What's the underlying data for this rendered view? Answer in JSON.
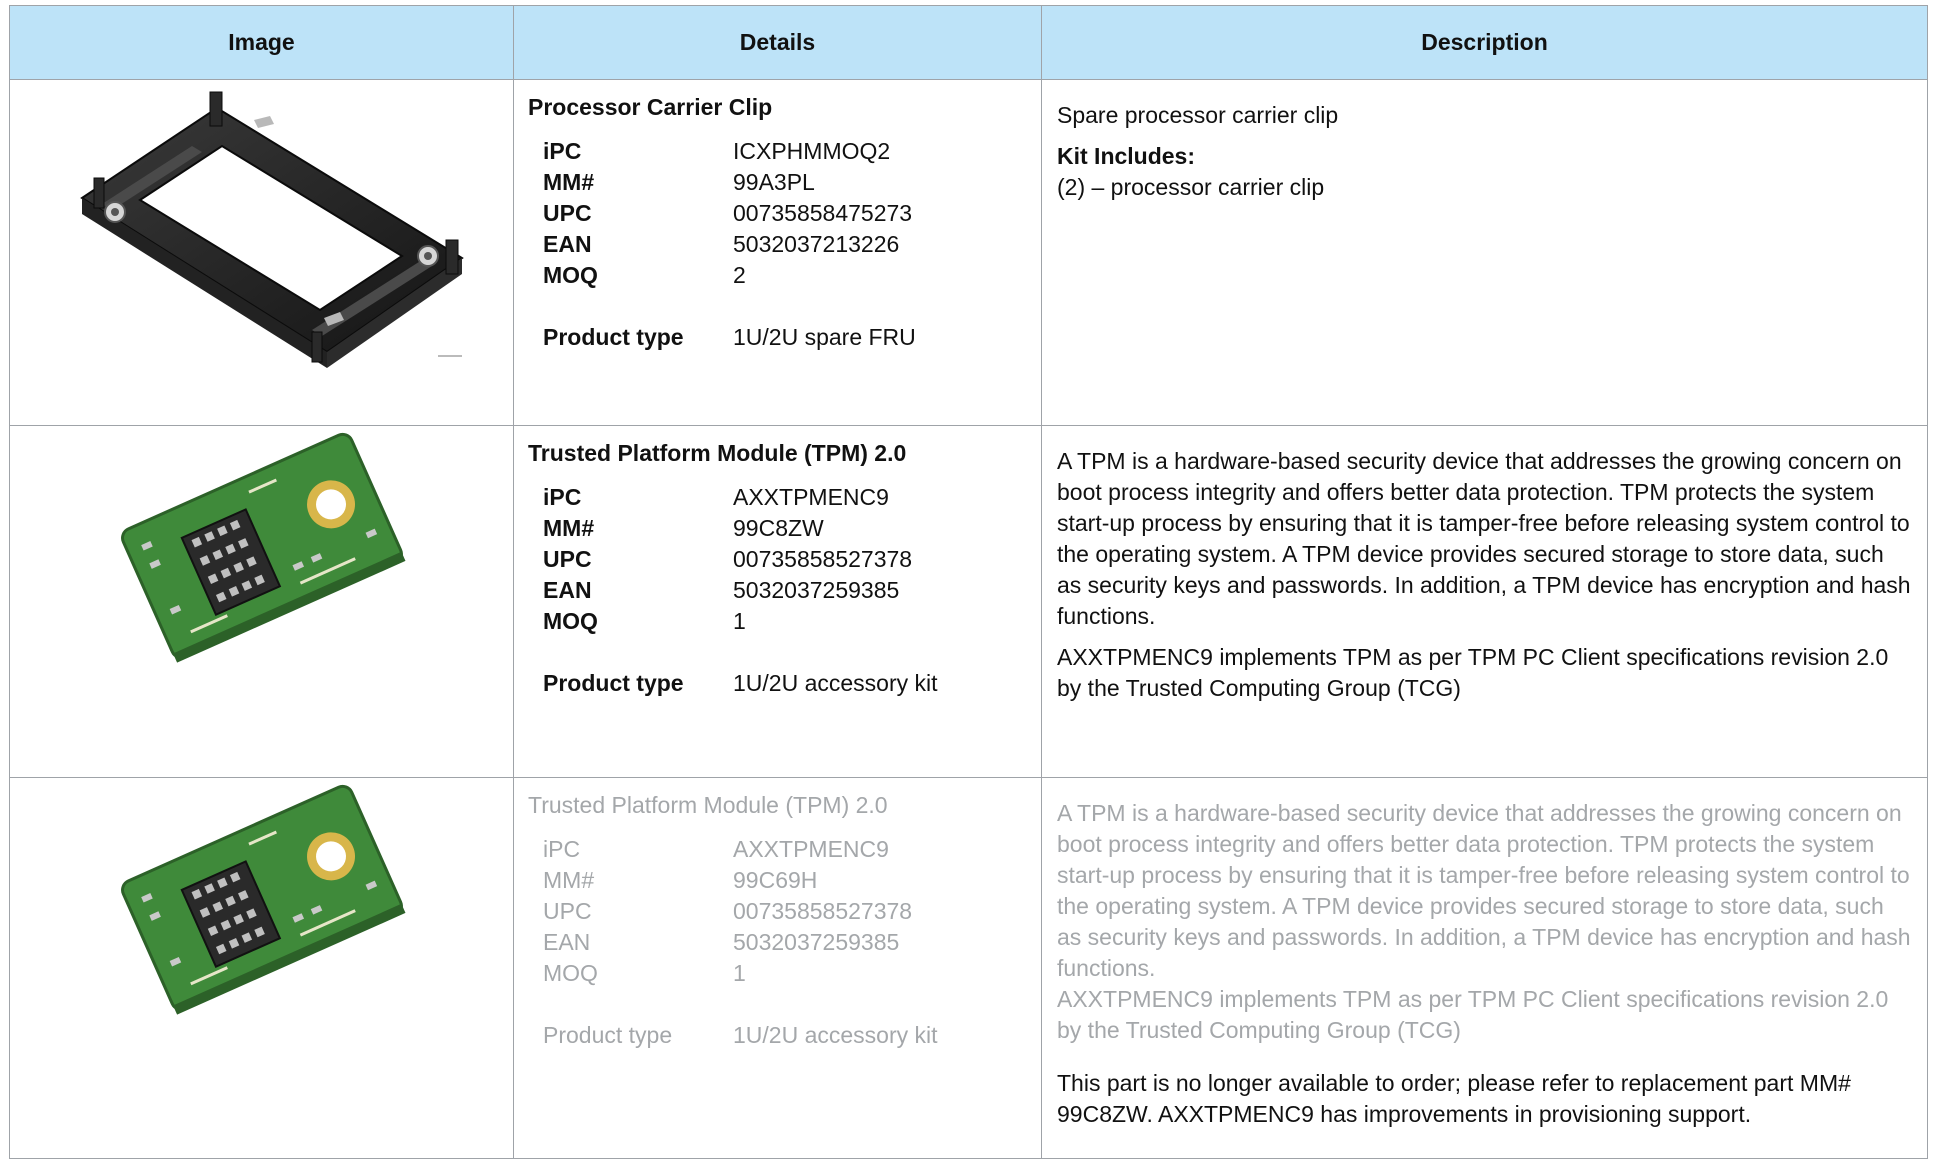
{
  "table": {
    "headers": [
      "Image",
      "Details",
      "Description"
    ],
    "rows": [
      {
        "image_icon": "processor-carrier-clip-image",
        "title": "Processor Carrier Clip",
        "specs": {
          "ipc_label": "iPC",
          "ipc": "ICXPHMMOQ2",
          "mm_label": "MM#",
          "mm": "99A3PL",
          "upc_label": "UPC",
          "upc": "00735858475273",
          "ean_label": "EAN",
          "ean": "5032037213226",
          "moq_label": "MOQ",
          "moq": "2",
          "type_label": "Product type",
          "type": "1U/2U spare FRU"
        },
        "description": "Spare processor carrier clip",
        "kit_title": "Kit Includes:",
        "kit_item": "(2) – processor carrier clip"
      },
      {
        "image_icon": "tpm-module-image",
        "title": "Trusted Platform Module (TPM) 2.0",
        "specs": {
          "ipc_label": "iPC",
          "ipc": "AXXTPMENC9",
          "mm_label": "MM#",
          "mm": "99C8ZW",
          "upc_label": "UPC",
          "upc": "00735858527378",
          "ean_label": "EAN",
          "ean": "5032037259385",
          "moq_label": "MOQ",
          "moq": "1",
          "type_label": "Product type",
          "type": "1U/2U accessory kit"
        },
        "description": "A TPM is a hardware-based security device that addresses the growing concern on boot process integrity and offers better data protection. TPM protects the system start-up process by ensuring that it is tamper-free before releasing system control to the operating system. A TPM device provides secured storage to store data, such as security keys and passwords. In addition, a TPM device has encryption and hash functions.",
        "description_2": "AXXTPMENC9 implements TPM as per TPM PC Client specifications revision 2.0 by the Trusted Computing Group (TCG)"
      },
      {
        "image_icon": "tpm-module-image",
        "title": "Trusted Platform Module (TPM) 2.0",
        "specs": {
          "ipc_label": "iPC",
          "ipc": "AXXTPMENC9",
          "mm_label": "MM#",
          "mm": "99C69H",
          "upc_label": "UPC",
          "upc": "00735858527378",
          "ean_label": "EAN",
          "ean": "5032037259385",
          "moq_label": "MOQ",
          "moq": "1",
          "type_label": "Product type",
          "type": "1U/2U accessory kit"
        },
        "description": "A TPM is a hardware-based security device that addresses the growing concern on boot process integrity and offers better data protection. TPM protects the system start-up process by ensuring that it is tamper-free before releasing system control to the operating system. A TPM device provides secured storage to store data, such as security keys and passwords. In addition, a TPM device has encryption and hash functions.",
        "description_2": "AXXTPMENC9 implements TPM as per TPM PC Client specifications revision 2.0 by the Trusted Computing Group (TCG)",
        "notice": "This part is no longer available to order; please refer to replacement part MM# 99C8ZW. AXXTPMENC9 has improvements in provisioning support."
      }
    ]
  },
  "colors": {
    "header_bg": "#bde3f8",
    "border": "#9fa3a8",
    "discontinued_text": "#a4a7aa",
    "pcb_green": "#3f8a3a"
  }
}
